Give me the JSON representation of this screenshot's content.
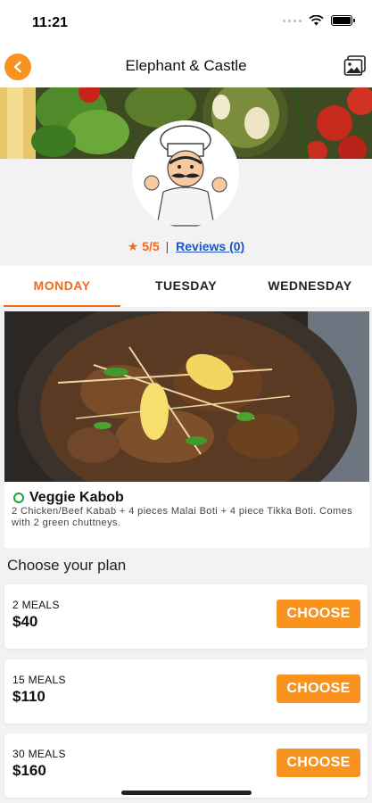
{
  "status_bar": {
    "time": "11:21"
  },
  "header": {
    "title": "Elephant & Castle"
  },
  "rating": {
    "star": "★",
    "score": "5/5",
    "separator": "|",
    "reviews_label": "Reviews (0)"
  },
  "tabs": [
    {
      "label": "MONDAY",
      "active": true
    },
    {
      "label": "TUESDAY",
      "active": false
    },
    {
      "label": "WEDNESDAY",
      "active": false
    }
  ],
  "dish": {
    "name": "Veggie Kabob",
    "description": "2 Chicken/Beef Kabab + 4 pieces Malai Boti + 4 piece Tikka Boti. Comes with 2 green chuttneys."
  },
  "plans": {
    "heading": "Choose your plan",
    "items": [
      {
        "meals": "2 MEALS",
        "price": "$40",
        "button": "CHOOSE"
      },
      {
        "meals": "15 MEALS",
        "price": "$110",
        "button": "CHOOSE"
      },
      {
        "meals": "30 MEALS",
        "price": "$160",
        "button": "CHOOSE"
      }
    ]
  },
  "colors": {
    "accent": "#f7931e",
    "accent_text": "#f06a1d",
    "link": "#1a56c4",
    "veg": "#1aa336"
  },
  "icons": {
    "back": "chevron-left-icon",
    "gallery": "image-gallery-icon",
    "signal": "signal-icon",
    "wifi": "wifi-icon",
    "battery": "battery-icon",
    "veg": "veg-indicator-icon"
  }
}
